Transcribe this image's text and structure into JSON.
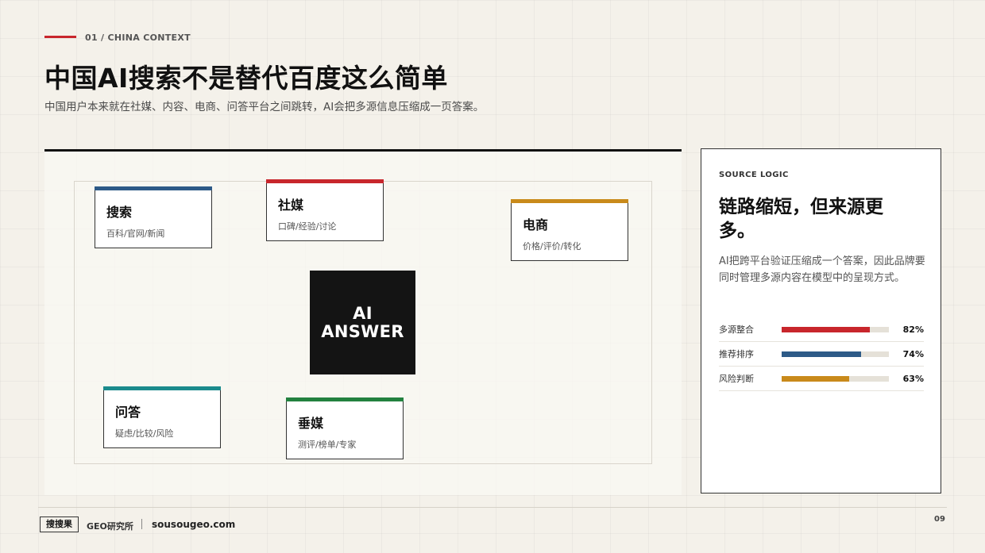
{
  "header": {
    "kicker": "01 / CHINA CONTEXT",
    "title": "中国AI搜索不是替代百度这么简单",
    "subtitle": "中国用户本来就在社媒、内容、电商、问答平台之间跳转，AI会把多源信息压缩成一页答案。"
  },
  "map": {
    "core": {
      "line1": "AI",
      "line2": "ANSWER"
    },
    "nodes": [
      {
        "title": "搜索",
        "sub": "百科/官网/新闻",
        "color": "#2d5a87"
      },
      {
        "title": "社媒",
        "sub": "口碑/经验/讨论",
        "color": "#c8262c"
      },
      {
        "title": "电商",
        "sub": "价格/评价/转化",
        "color": "#c98a1b"
      },
      {
        "title": "问答",
        "sub": "疑虑/比较/风险",
        "color": "#1b8a8c"
      },
      {
        "title": "垂媒",
        "sub": "测评/榜单/专家",
        "color": "#23813f"
      }
    ]
  },
  "card": {
    "kicker": "SOURCE LOGIC",
    "title": "链路缩短，但来源更多。",
    "body": "AI把跨平台验证压缩成一个答案，因此品牌要同时管理多源内容在模型中的呈现方式。",
    "metrics": [
      {
        "label": "多源整合",
        "value": "82%",
        "fraction": 0.82,
        "color": "#c8262c"
      },
      {
        "label": "推荐排序",
        "value": "74%",
        "fraction": 0.74,
        "color": "#2d5a87"
      },
      {
        "label": "风险判断",
        "value": "63%",
        "fraction": 0.63,
        "color": "#c98a1b"
      }
    ]
  },
  "footer": {
    "brand": "搜搜果",
    "lab": "GEO研究所",
    "url": "sousougeo.com",
    "page": "09"
  },
  "colors": {
    "accent": "#c8262c",
    "background": "#f4f1ea",
    "ink": "#111111"
  }
}
